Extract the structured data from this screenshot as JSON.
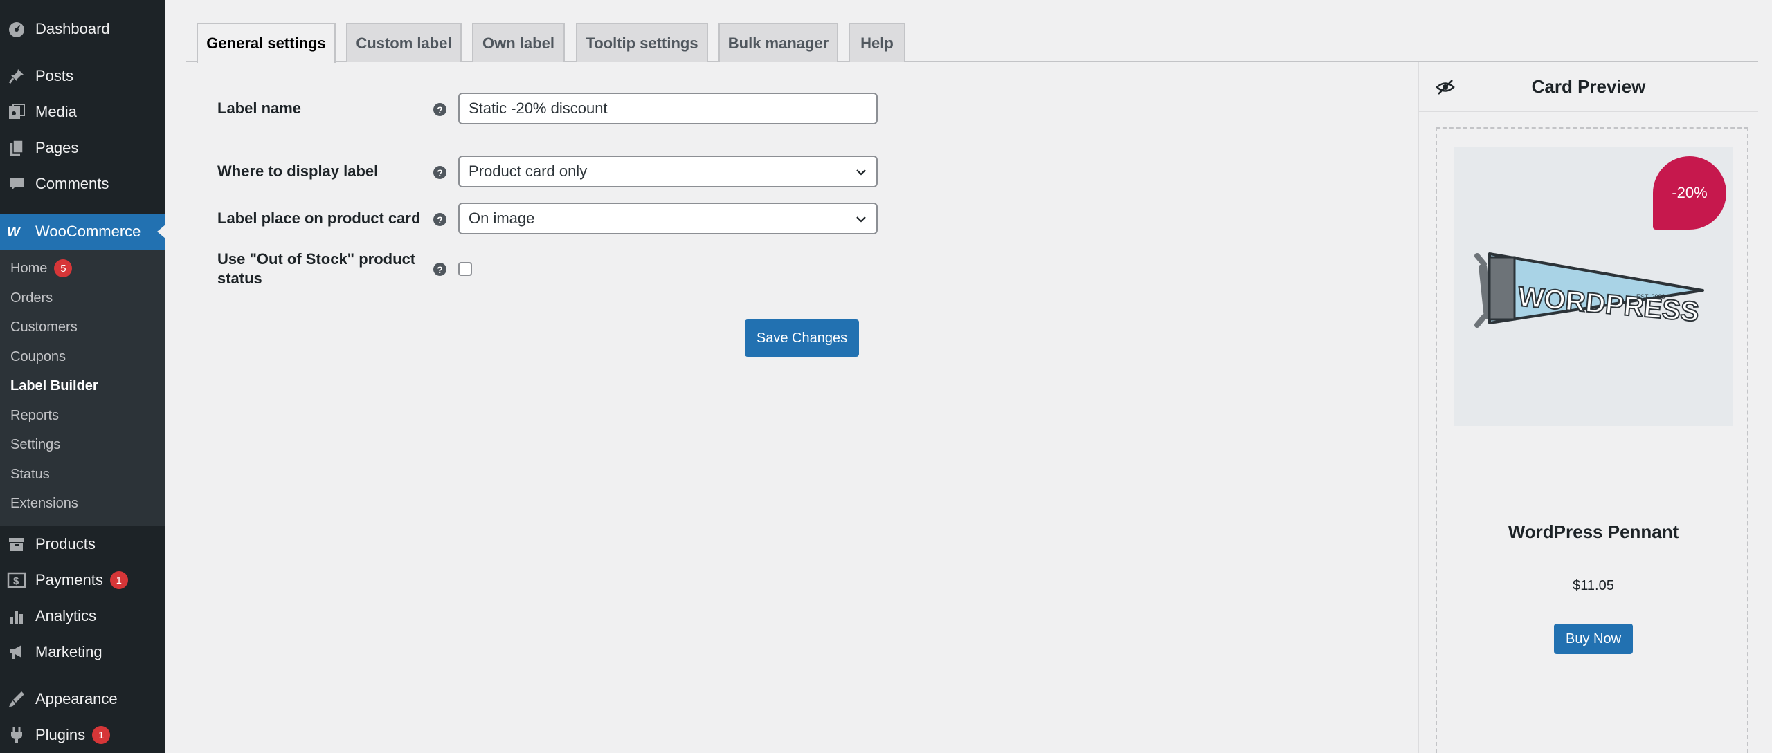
{
  "sidebar": {
    "top_items": [
      {
        "label": "Dashboard",
        "icon": "dashboard-icon"
      },
      {
        "label": "Posts",
        "icon": "pin-icon"
      },
      {
        "label": "Media",
        "icon": "media-icon"
      },
      {
        "label": "Pages",
        "icon": "pages-icon"
      },
      {
        "label": "Comments",
        "icon": "comment-icon"
      },
      {
        "label": "WooCommerce",
        "icon": "woocommerce-icon"
      }
    ],
    "woo_submenu": [
      {
        "label": "Home",
        "badge": "5"
      },
      {
        "label": "Orders"
      },
      {
        "label": "Customers"
      },
      {
        "label": "Coupons"
      },
      {
        "label": "Label Builder"
      },
      {
        "label": "Reports"
      },
      {
        "label": "Settings"
      },
      {
        "label": "Status"
      },
      {
        "label": "Extensions"
      }
    ],
    "bottom_items": [
      {
        "label": "Products",
        "icon": "archive-icon"
      },
      {
        "label": "Payments",
        "icon": "dollar-icon",
        "badge": "1"
      },
      {
        "label": "Analytics",
        "icon": "bar-chart-icon"
      },
      {
        "label": "Marketing",
        "icon": "megaphone-icon"
      },
      {
        "label": "Appearance",
        "icon": "brush-icon"
      },
      {
        "label": "Plugins",
        "icon": "plug-icon",
        "badge": "1"
      }
    ]
  },
  "tabs": [
    {
      "label": "General settings",
      "active": true
    },
    {
      "label": "Custom label"
    },
    {
      "label": "Own label"
    },
    {
      "label": "Tooltip settings"
    },
    {
      "label": "Bulk manager"
    },
    {
      "label": "Help"
    }
  ],
  "form": {
    "label_name": {
      "label": "Label name",
      "value": "Static -20% discount"
    },
    "display_where": {
      "label": "Where to display label",
      "value": "Product card only"
    },
    "label_place": {
      "label": "Label place on product card",
      "value": "On image"
    },
    "out_of_stock": {
      "label_line1": "Use \"Out of Stock\" product",
      "label_line2": "status",
      "checked": false
    },
    "save_label": "Save Changes"
  },
  "preview": {
    "title": "Card Preview",
    "sale_badge": "-20%",
    "badge_color": "#c6184d",
    "product_name": "WordPress Pennant",
    "price": "$11.05",
    "buy_label": "Buy Now",
    "pennant_text": "WORDPRESS",
    "pennant_small": "EST. 2003"
  },
  "colors": {
    "accent": "#2271b1",
    "sidebar": "#1d2327",
    "badge": "#d63638"
  }
}
